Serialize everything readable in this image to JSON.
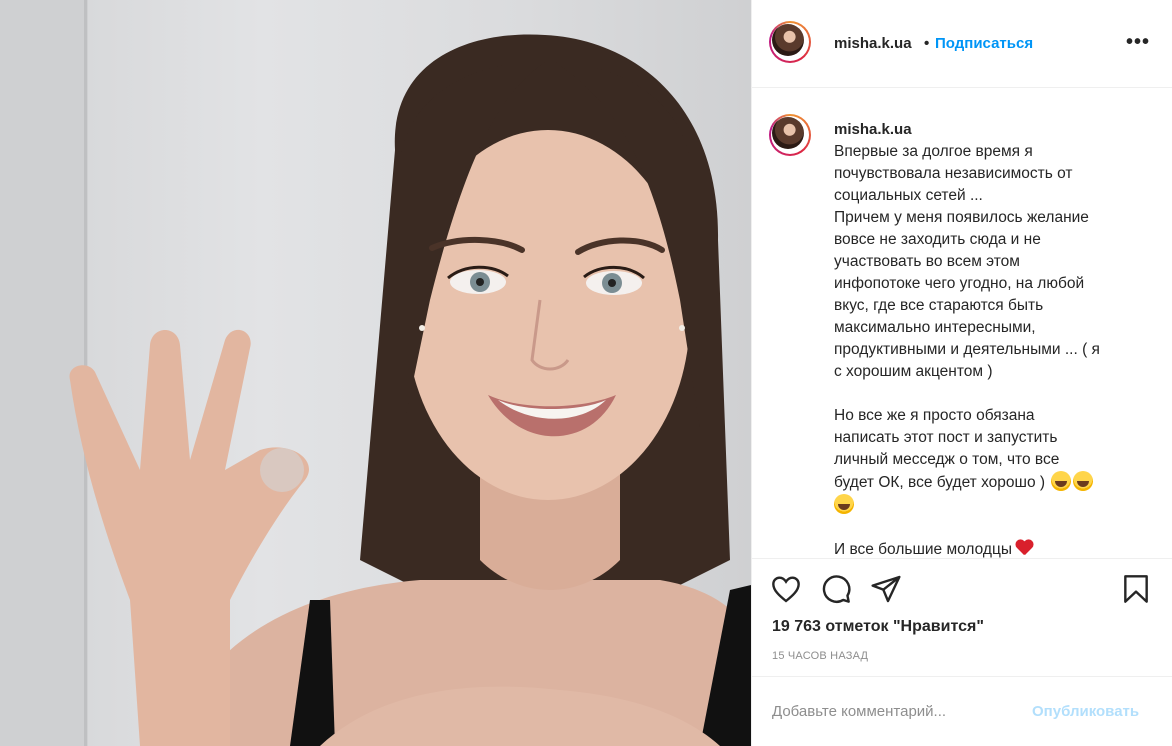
{
  "post": {
    "username": "misha.k.ua",
    "dot": "•",
    "follow_label": "Подписаться",
    "more_label": "•••",
    "caption_lines": [
      "Впервые за долгое время я",
      "почувствовала независимость от",
      "социальных сетей ...",
      "Причем у меня появилось желание",
      "вовсе не заходить сюда и не",
      "участвовать во всем этом",
      "инфопотоке чего угодно, на любой",
      "вкус, где все стараются быть",
      "максимально интересными,",
      "продуктивными и деятельными ... ( я",
      "с хорошим акцентом )",
      "",
      "Но все же я просто обязана",
      "написать этот пост и запустить",
      "личный месседж о том, что все",
      "будет ОК, все будет хорошо )",
      "",
      "",
      "И все большие молодцы"
    ],
    "likes": "19 763 отметок \"Нравится\"",
    "timestamp": "15 ЧАСОВ НАЗАД",
    "comment_placeholder": "Добавьте комментарий...",
    "publish_label": "Опубликовать"
  },
  "icons": {
    "like": "heart-outline-icon",
    "comment": "comment-bubble-icon",
    "share": "paper-plane-icon",
    "save": "bookmark-icon"
  },
  "colors": {
    "link": "#0095f6",
    "publish_disabled": "#b2dffc",
    "muted": "#8e8e8e",
    "text": "#262626"
  }
}
